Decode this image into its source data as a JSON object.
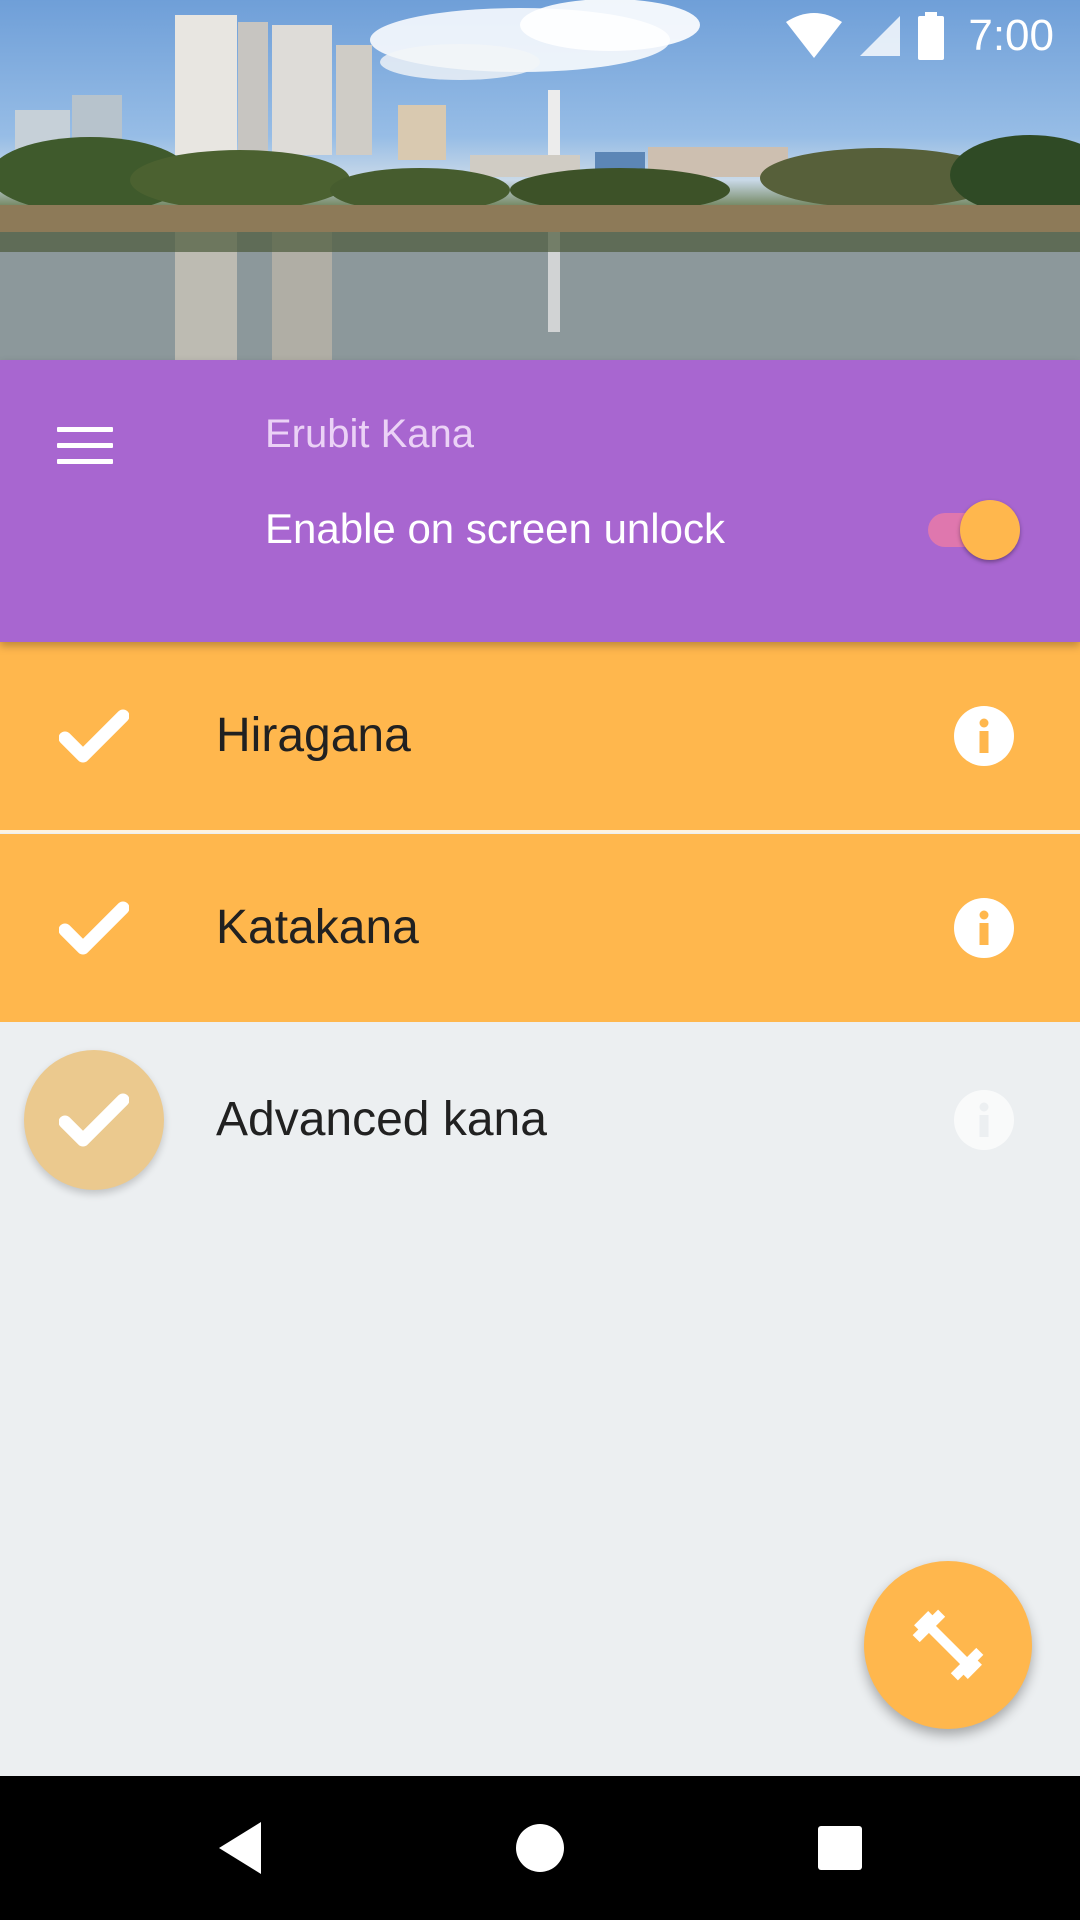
{
  "status_bar": {
    "time": "7:00",
    "icons": [
      "wifi-icon",
      "cell-signal-icon",
      "battery-icon"
    ]
  },
  "header": {
    "image": "city-skyline-photo",
    "app_title": "Erubit Kana",
    "unlock_label": "Enable on screen unlock",
    "unlock_enabled": true
  },
  "colors": {
    "app_bar": "#a866d0",
    "accent": "#ffb74d",
    "background": "#eceff1",
    "toggle_track": "#e97aa8"
  },
  "courses": [
    {
      "label": "Hiragana",
      "selected": true,
      "icon": "check-icon",
      "info_icon": "info-icon"
    },
    {
      "label": "Katakana",
      "selected": true,
      "icon": "check-icon",
      "info_icon": "info-icon"
    },
    {
      "label": "Advanced kana",
      "selected": false,
      "icon": "check-icon",
      "info_icon": "info-icon"
    }
  ],
  "fab": {
    "icon": "dumbbell-icon"
  },
  "nav_bar": {
    "buttons": [
      "back-icon",
      "home-icon",
      "recents-icon"
    ]
  }
}
